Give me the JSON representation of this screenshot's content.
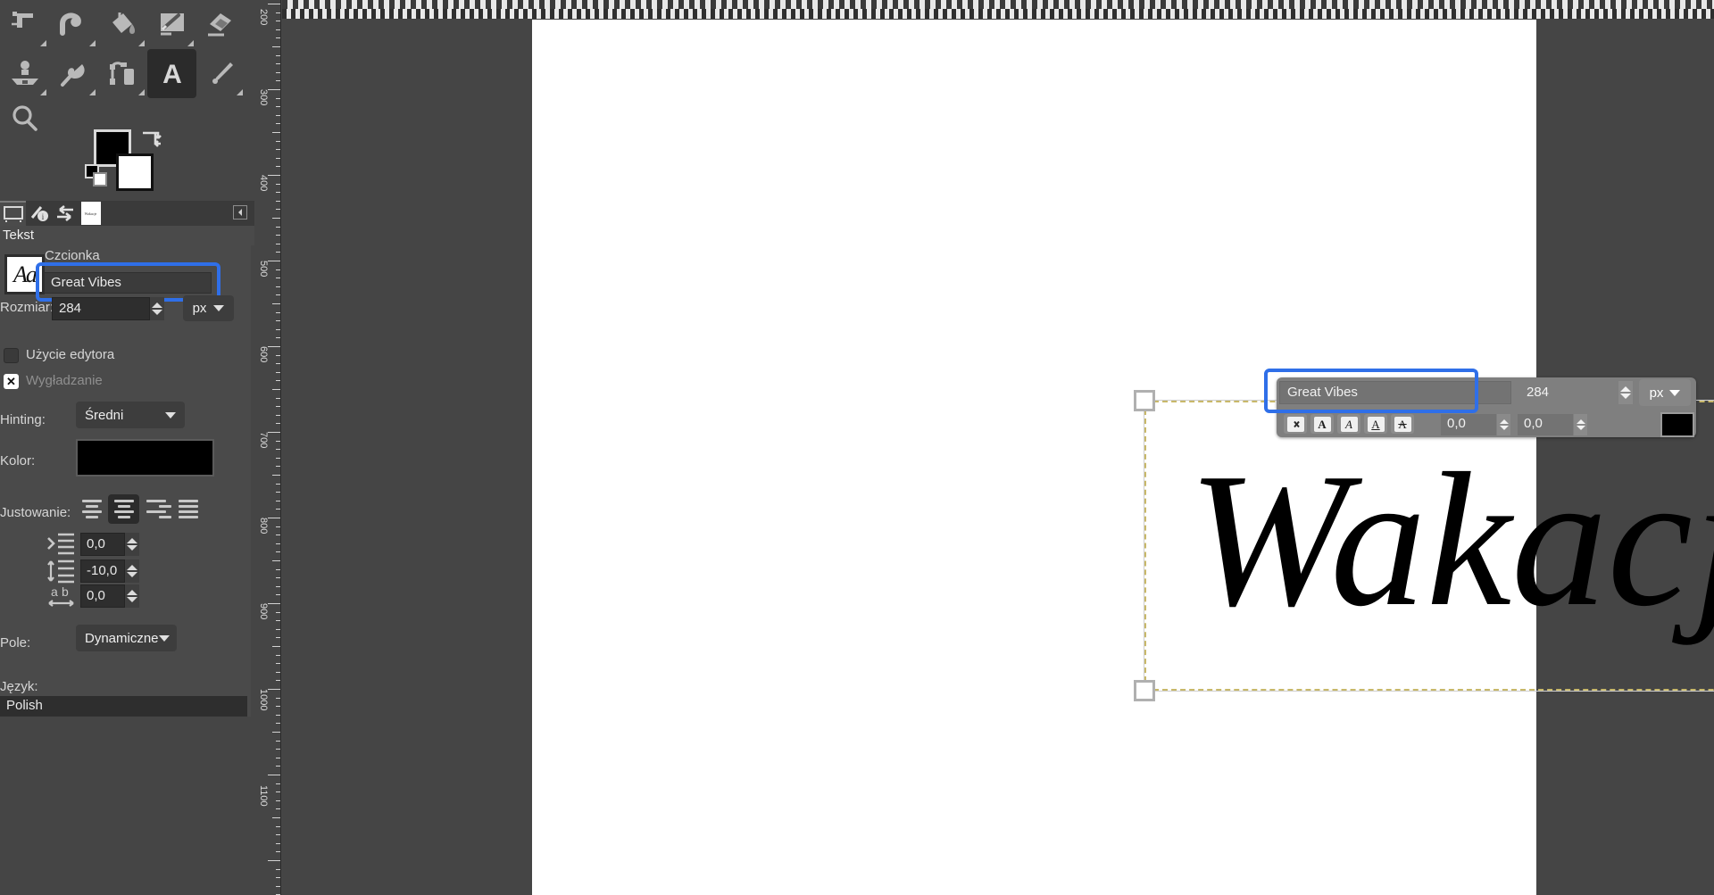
{
  "app": {
    "name": "GIMP",
    "theme_bg": "#454545",
    "accent_highlight": "#2f6fe8"
  },
  "toolbox": {
    "tools": [
      {
        "name": "transform-tool",
        "icon": "transform-icon"
      },
      {
        "name": "warp-tool",
        "icon": "warp-icon"
      },
      {
        "name": "bucket-fill-tool",
        "icon": "bucket-fill-icon"
      },
      {
        "name": "paintbrush-tool",
        "icon": "paintbrush-icon"
      },
      {
        "name": "eraser-tool",
        "icon": "eraser-icon"
      },
      {
        "name": "clone-tool",
        "icon": "clone-icon"
      },
      {
        "name": "smudge-tool",
        "icon": "smudge-icon"
      },
      {
        "name": "ink-tool",
        "icon": "ink-icon"
      },
      {
        "name": "text-tool",
        "icon": "text-a-icon",
        "selected": true
      },
      {
        "name": "color-picker-tool",
        "icon": "eyedropper-icon"
      },
      {
        "name": "zoom-tool",
        "icon": "magnifier-icon"
      }
    ],
    "foreground_color": "#000000",
    "background_color": "#ffffff"
  },
  "dock": {
    "tabs": [
      {
        "name": "tool-options-tab",
        "icon": "tool-options-icon",
        "selected": true
      },
      {
        "name": "device-status-tab",
        "icon": "device-status-icon"
      },
      {
        "name": "undo-history-tab",
        "icon": "undo-history-icon"
      },
      {
        "name": "images-tab",
        "icon": "image-thumbnail-icon",
        "thumb_text": "Wakacje"
      }
    ],
    "collapse_icon": "collapse-dock-icon"
  },
  "tool_options": {
    "title": "Tekst",
    "font_label": "Czcionka",
    "font_value": "Great Vibes",
    "font_preview_glyph": "Aa",
    "size_label": "Rozmiar:",
    "size_value": "284",
    "size_unit": "px",
    "use_editor_label": "Użycie edytora",
    "use_editor_checked": false,
    "antialias_label": "Wygładzanie",
    "antialias_checked": true,
    "hinting_label": "Hinting:",
    "hinting_value": "Średni",
    "color_label": "Kolor:",
    "color_value": "#000000",
    "justify_label": "Justowanie:",
    "justify_options": [
      "left",
      "center",
      "right",
      "fill"
    ],
    "justify_selected": "center",
    "indent_label": "indent",
    "indent_value": "0,0",
    "line_spacing_label": "line-spacing",
    "line_spacing_value": "-10,0",
    "letter_spacing_label": "letter-spacing",
    "letter_spacing_value": "0,0",
    "box_label": "Pole:",
    "box_value": "Dynamiczne",
    "language_label": "Język:",
    "language_value": "Polish"
  },
  "on_canvas_toolbar": {
    "font_value": "Great Vibes",
    "size_value": "284",
    "unit_value": "px",
    "buttons": [
      {
        "name": "clear-style-button",
        "glyph": "⌫"
      },
      {
        "name": "bold-button",
        "glyph": "A"
      },
      {
        "name": "italic-button",
        "glyph": "A"
      },
      {
        "name": "underline-button",
        "glyph": "A"
      },
      {
        "name": "strikethrough-button",
        "glyph": "A"
      }
    ],
    "baseline_value": "0,0",
    "kerning_value": "0,0",
    "color_value": "#000000"
  },
  "canvas": {
    "text_content": "Wakacje",
    "vertical_ruler_ticks": [
      "200",
      "300",
      "400",
      "500",
      "600",
      "700",
      "800",
      "900",
      "1000",
      "1100"
    ],
    "selection_border": "marching-ants"
  }
}
